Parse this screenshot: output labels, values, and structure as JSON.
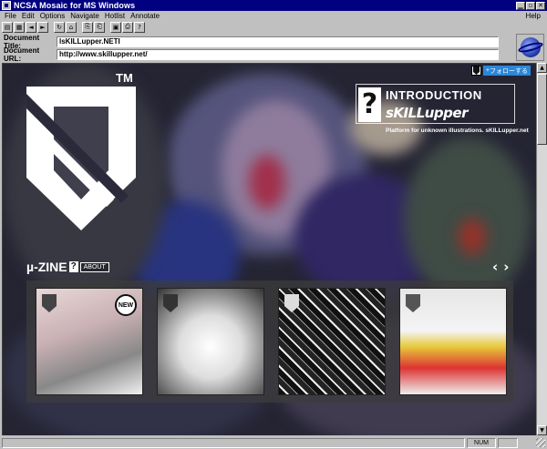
{
  "window": {
    "title": "NCSA Mosaic for MS Windows",
    "minimize_glyph": "▁",
    "maximize_glyph": "▫",
    "close_glyph": "✕"
  },
  "menu": {
    "items": [
      "File",
      "Edit",
      "Options",
      "Navigate",
      "Hotlist",
      "Annotate"
    ],
    "help": "Help"
  },
  "toolbar": {
    "buttons": [
      {
        "name": "open-icon",
        "glyph": "▤"
      },
      {
        "name": "save-icon",
        "glyph": "▦"
      },
      {
        "name": "back-icon",
        "glyph": "◄"
      },
      {
        "name": "forward-icon",
        "glyph": "►"
      },
      {
        "name": "reload-icon",
        "glyph": "↻"
      },
      {
        "name": "home-icon",
        "glyph": "⌂"
      },
      {
        "name": "copy-icon",
        "glyph": "⎘"
      },
      {
        "name": "paste-icon",
        "glyph": "⎗"
      },
      {
        "name": "load-images-icon",
        "glyph": "▣"
      },
      {
        "name": "print-icon",
        "glyph": "⎙"
      },
      {
        "name": "help-icon",
        "glyph": "?"
      }
    ]
  },
  "address": {
    "title_label": "Document Title:",
    "title_value": "lsKILLupper.NETI",
    "url_label": "Document URL:",
    "url_value": "http://www.skillupper.net/"
  },
  "page": {
    "tm": "TM",
    "follow_label": "フォローする",
    "intro_title": "INTRODUCTION",
    "intro_brand": "sKILLupper",
    "intro_q": "?",
    "tagline": "Platform for unknown illustrations.    sKILLupper.net",
    "uzine_label": "µ-ZINE",
    "uzine_q": "?",
    "about_label": "ABOUT",
    "prev_arrow": "‹",
    "next_arrow": "›",
    "new_badge": "NEW"
  },
  "status": {
    "text": "",
    "num": "NUM"
  }
}
